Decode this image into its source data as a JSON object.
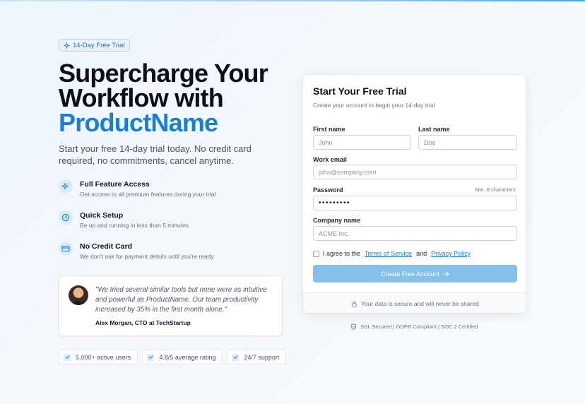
{
  "badge": {
    "label": "14-Day Free Trial",
    "icon": "sparkle-icon"
  },
  "hero": {
    "headline_line1": "Supercharge Your",
    "headline_line2": "Workflow with",
    "brand": "ProductName",
    "subtitle": "Start your free 14-day trial today. No credit card required, no commitments, cancel anytime."
  },
  "features": [
    {
      "icon": "sparkles-icon",
      "title": "Full Feature Access",
      "desc": "Get access to all premium features during your trial"
    },
    {
      "icon": "clock-icon",
      "title": "Quick Setup",
      "desc": "Be up and running in less than 5 minutes"
    },
    {
      "icon": "credit-card-icon",
      "title": "No Credit Card",
      "desc": "We don't ask for payment details until you're ready"
    }
  ],
  "testimonial": {
    "quote": "\"We tried several similar tools but none were as intuitive and powerful as ProductName. Our team productivity increased by 35% in the first month alone.\"",
    "author": "Alex Morgan, CTO at TechStartup"
  },
  "stats": [
    {
      "label": "5,000+ active users"
    },
    {
      "label": "4.8/5 average rating"
    },
    {
      "label": "24/7 support"
    }
  ],
  "form": {
    "title": "Start Your Free Trial",
    "subtitle": "Create your account to begin your 14-day trial",
    "first_name": {
      "label": "First name",
      "placeholder": "John",
      "value": ""
    },
    "last_name": {
      "label": "Last name",
      "placeholder": "Doe",
      "value": ""
    },
    "email": {
      "label": "Work email",
      "placeholder": "john@company.com",
      "value": ""
    },
    "password": {
      "label": "Password",
      "hint": "Min. 8 characters",
      "value": "•••••••••"
    },
    "company": {
      "label": "Company name",
      "placeholder": "ACME Inc.",
      "value": ""
    },
    "terms": {
      "prefix": "I agree to the",
      "terms_link": "Terms of Service",
      "and": "and",
      "privacy_link": "Privacy Policy",
      "checked": false
    },
    "submit_label": "Create Free Account",
    "secure_note": "Your data is secure and will never be shared"
  },
  "compliance": "SSL Secured | GDPR Compliant | SOC 2 Certified",
  "colors": {
    "brand": "#1a7fcf",
    "button": "#86bfe8",
    "icon_bg": "#dcebfa"
  }
}
